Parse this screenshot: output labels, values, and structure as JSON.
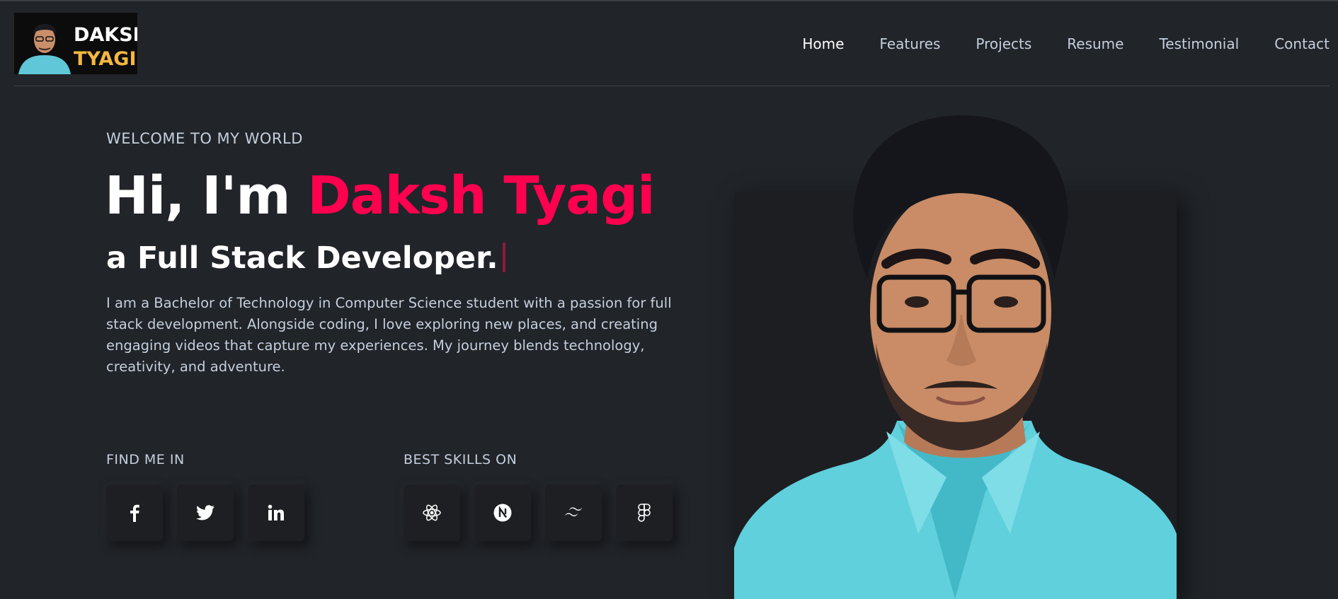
{
  "logo": {
    "line1": "DAKSH",
    "line2": "TYAGI",
    "accent_color": "#f4b740"
  },
  "nav": {
    "items": [
      {
        "label": "Home",
        "active": true
      },
      {
        "label": "Features",
        "active": false
      },
      {
        "label": "Projects",
        "active": false
      },
      {
        "label": "Resume",
        "active": false
      },
      {
        "label": "Testimonial",
        "active": false
      },
      {
        "label": "Contact",
        "active": false
      }
    ]
  },
  "hero": {
    "welcome": "WELCOME TO MY WORLD",
    "greeting": "Hi, I'm ",
    "name": "Daksh Tyagi",
    "role": "a Full Stack Developer.",
    "bio": "I am a Bachelor of Technology in Computer Science student with a passion for full stack development. Alongside coding, I love exploring new places, and creating engaging videos that capture my experiences. My journey blends technology, creativity, and adventure.",
    "accent_color": "#ff014f"
  },
  "social": {
    "label": "FIND ME IN",
    "icons": [
      "facebook-icon",
      "twitter-icon",
      "linkedin-icon"
    ]
  },
  "skills": {
    "label": "BEST SKILLS ON",
    "icons": [
      "react-icon",
      "nextjs-icon",
      "tailwind-icon",
      "figma-icon"
    ]
  },
  "colors": {
    "background": "#212428",
    "text": "#c4cfde",
    "heading": "#ffffff",
    "accent": "#ff014f"
  }
}
